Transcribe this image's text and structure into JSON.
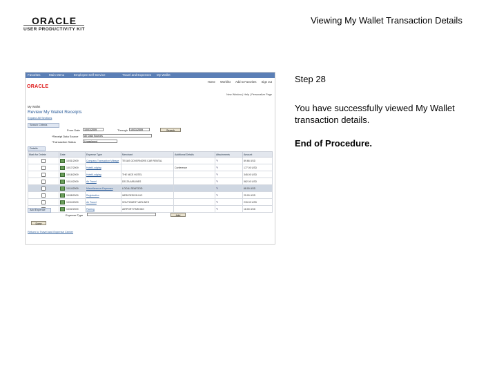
{
  "logo": {
    "brand": "ORACLE",
    "sub": "USER PRODUCTIVITY KIT"
  },
  "slide": {
    "title": "Viewing My Wallet Transaction Details",
    "step": "Step 28",
    "description": "You have successfully viewed My Wallet transaction details.",
    "end": "End of Procedure."
  },
  "app": {
    "nav": [
      "Favorites",
      "Main Menu",
      "Employee Self-Service",
      "Travel and Expenses",
      "My Wallet"
    ],
    "header_links": [
      "Home",
      "Worklist",
      "Add to Favorites",
      "Sign out"
    ],
    "brand": "ORACLE",
    "top_links": "New Window | Help | Personalize Page",
    "breadcrumb": "My Wallet",
    "page_title": "Review My Wallet Receipts",
    "related_link": "Expand All Sections",
    "search_section": "Search Criteria",
    "from_date_label": "From Date",
    "from_date": "10/01/2009",
    "through_label": "Through",
    "through_date": "10/31/2009",
    "search_button": "Search",
    "source_label": "*Receipt Data Source",
    "source_value": "All Data Sources",
    "status_label": "*Transaction Status",
    "status_value": "Unassigned",
    "details_section": "Details",
    "columns": [
      "Mark for Delete",
      "Date",
      "Expense Type",
      "Merchant",
      "Additional Details",
      "Attachments",
      "Amount"
    ],
    "rows": [
      {
        "date": "10/31/2009",
        "type": "Company Transaction Mileage",
        "merchant": "TEXAS GOVERNORS CAR RENTAL",
        "details": "",
        "amount": "89.66 USD",
        "selected": false
      },
      {
        "date": "10/17/2009",
        "type": "Hotel/Lodging",
        "merchant": "",
        "details": "Conference",
        "amount": "177.00 USD",
        "selected": false
      },
      {
        "date": "10/16/2009",
        "type": "Hotel/Lodging",
        "merchant": "THE NICE HOTEL",
        "details": "",
        "amount": "345.00 USD",
        "selected": false
      },
      {
        "date": "10/14/2009",
        "type": "Air Travel",
        "merchant": "DELTA AIRLINES",
        "details": "",
        "amount": "562.00 USD",
        "selected": false
      },
      {
        "date": "10/14/2009",
        "type": "Miscellaneous Expenses",
        "merchant": "LOCAL SEAFOOD",
        "details": "",
        "amount": "68.00 USD",
        "selected": true
      },
      {
        "date": "10/08/2009",
        "type": "Registration",
        "merchant": "WEB DESIGN INC",
        "details": "",
        "amount": "25.00 USD",
        "selected": false
      },
      {
        "date": "10/04/2009",
        "type": "Air Travel",
        "merchant": "SOUTHWEST AIRLINES",
        "details": "",
        "amount": "215.00 USD",
        "selected": false
      },
      {
        "date": "10/02/2009",
        "type": "Parking",
        "merchant": "AIRPORT PARKING",
        "details": "",
        "amount": "18.00 USD",
        "selected": false
      }
    ],
    "add_section": "Add Expense",
    "expense_type_label": "Expense Type",
    "add_button": "Add",
    "done_button": "Done",
    "footer_link": "Return to Travel and Expense Center"
  }
}
